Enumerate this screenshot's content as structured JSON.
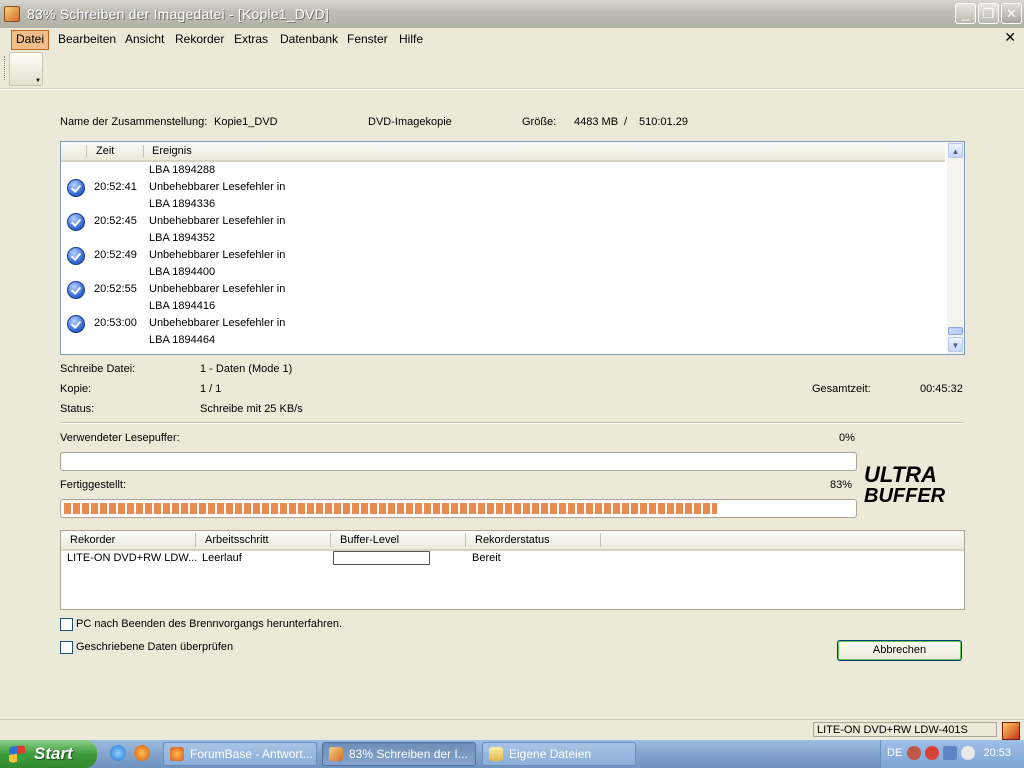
{
  "window": {
    "title": "83% Schreiben der Imagedatei - [Kopie1_DVD]",
    "controls": [
      "minimize",
      "maximize",
      "close"
    ]
  },
  "menu": {
    "items": [
      "Datei",
      "Bearbeiten",
      "Ansicht",
      "Rekorder",
      "Extras",
      "Datenbank",
      "Fenster",
      "Hilfe"
    ],
    "close_glyph": "✕"
  },
  "info": {
    "name_label": "Name der Zusammenstellung:",
    "name_value": "Kopie1_DVD",
    "type_value": "DVD-Imagekopie",
    "size_label": "Größe:",
    "size_value": "4483 MB",
    "size_sep": "/",
    "size_time": "510:01.29"
  },
  "log": {
    "headers": [
      "Zeit",
      "Ereignis"
    ],
    "lines": [
      {
        "time": "",
        "event": "LBA 1894288",
        "icon": false
      },
      {
        "time": "20:52:41",
        "event": "Unbehebbarer Lesefehler in",
        "icon": true
      },
      {
        "time": "",
        "event": "LBA 1894336",
        "icon": false
      },
      {
        "time": "20:52:45",
        "event": "Unbehebbarer Lesefehler in",
        "icon": true
      },
      {
        "time": "",
        "event": "LBA 1894352",
        "icon": false
      },
      {
        "time": "20:52:49",
        "event": "Unbehebbarer Lesefehler in",
        "icon": true
      },
      {
        "time": "",
        "event": "LBA 1894400",
        "icon": false
      },
      {
        "time": "20:52:55",
        "event": "Unbehebbarer Lesefehler in",
        "icon": true
      },
      {
        "time": "",
        "event": "LBA 1894416",
        "icon": false
      },
      {
        "time": "20:53:00",
        "event": "Unbehebbarer Lesefehler in",
        "icon": true
      },
      {
        "time": "",
        "event": "LBA 1894464",
        "icon": false
      }
    ]
  },
  "details": {
    "write_file_label": "Schreibe Datei:",
    "write_file_value": "1 - Daten (Mode 1)",
    "copy_label": "Kopie:",
    "copy_value": "1 / 1",
    "total_time_label": "Gesamtzeit:",
    "total_time_value": "00:45:32",
    "status_label": "Status:",
    "status_value": "Schreibe mit 25 KB/s"
  },
  "buffer": {
    "label": "Verwendeter Lesepuffer:",
    "percent_text": "0%",
    "fraction": 0.0
  },
  "progress": {
    "label": "Fertiggestellt:",
    "percent_text": "83%",
    "fraction": 0.83
  },
  "logo": {
    "line1": "ULTRA",
    "line2": "BUFFER"
  },
  "recorder": {
    "headers": [
      "Rekorder",
      "Arbeitsschritt",
      "Buffer-Level",
      "Rekorderstatus"
    ],
    "row": {
      "name": "LITE-ON DVD+RW LDW...",
      "step": "Leerlauf",
      "buffer_fraction": 0.0,
      "status": "Bereit"
    }
  },
  "options": {
    "shutdown_label": "PC nach Beenden des Brennvorgangs herunterfahren.",
    "shutdown_checked": false,
    "verify_label": "Geschriebene Daten überprüfen",
    "verify_checked": false
  },
  "cancel_label": "Abbrechen",
  "statusbar": {
    "device": "LITE-ON  DVD+RW LDW-401S"
  },
  "taskbar": {
    "start_label": "Start",
    "tasks": [
      {
        "label": "ForumBase - Antwort...",
        "icon": "firefox-icon",
        "active": false
      },
      {
        "label": "83% Schreiben der I...",
        "icon": "burn-app-icon",
        "active": true
      },
      {
        "label": "Eigene Dateien",
        "icon": "folder-icon",
        "active": false
      }
    ],
    "lang": "DE",
    "clock": "20:53"
  }
}
